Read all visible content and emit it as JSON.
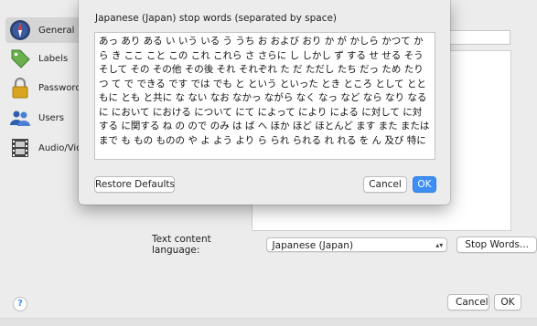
{
  "sidebar": {
    "items": [
      {
        "label": "General",
        "icon": "compass-icon",
        "selected": true
      },
      {
        "label": "Labels",
        "icon": "tag-icon",
        "selected": false
      },
      {
        "label": "Passwords",
        "icon": "lock-icon",
        "selected": false
      },
      {
        "label": "Users",
        "icon": "users-icon",
        "selected": false
      },
      {
        "label": "Audio/Video",
        "icon": "film-icon",
        "selected": false
      }
    ]
  },
  "main": {
    "language_label": "Text content language:",
    "language_value": "Japanese (Japan)",
    "stop_words_button": "Stop Words...",
    "cancel_label": "Cancel",
    "ok_label": "OK",
    "help_label": "?"
  },
  "sheet": {
    "title": "Japanese (Japan) stop words (separated by space)",
    "stop_words": "あっ あり ある い いう いる う うち お および おり か が かしら かつて から き ここ こと この これ これら さ さらに し しかし ず する せ せる そう そして その その他 その後 それ それぞれ た だ ただし たち だっ ため たり つ て で できる です では でも と という といった とき ところ として とともに とも と共に な ない なお なかっ ながら なく なっ など なら なり なる に において における について にて によって により による に対して に対する に関する ね の ので のみ は ば へ ほか ほど ほとんど ます また または まで も もの ものの や よ よう より ら られ られる れ れる を ん 及び 特に",
    "restore_label": "Restore Defaults",
    "cancel_label": "Cancel",
    "ok_label": "OK"
  },
  "colors": {
    "accent": "#3d8ef5",
    "window_bg": "#ececec"
  }
}
